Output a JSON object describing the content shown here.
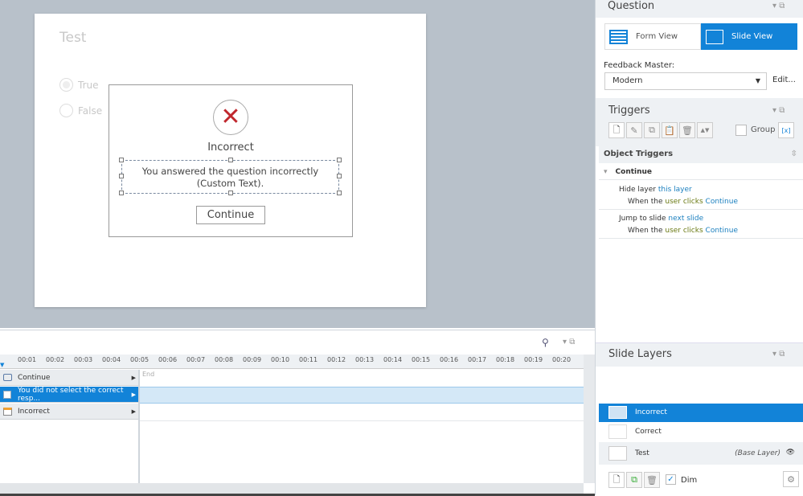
{
  "slide": {
    "title": "Test",
    "options": [
      "True",
      "False"
    ],
    "feedback_title": "Incorrect",
    "feedback_text": "You answered the question incorrectly (Custom Text).",
    "continue_label": "Continue"
  },
  "timeline": {
    "ticks": [
      "00:01",
      "00:02",
      "00:03",
      "00:04",
      "00:05",
      "00:06",
      "00:07",
      "00:08",
      "00:09",
      "00:10",
      "00:11",
      "00:12",
      "00:13",
      "00:14",
      "00:15",
      "00:16",
      "00:17",
      "00:18",
      "00:19",
      "00:20"
    ],
    "end_label": "End",
    "rows": [
      {
        "label": "Continue"
      },
      {
        "label": "You did not select the correct resp..."
      },
      {
        "label": "Incorrect"
      }
    ]
  },
  "question": {
    "title": "Question",
    "form_view": "Form View",
    "slide_view": "Slide View",
    "feedback_master_label": "Feedback Master:",
    "feedback_master_value": "Modern",
    "edit_label": "Edit..."
  },
  "triggers": {
    "title": "Triggers",
    "group_label": "Group",
    "object_triggers": "Object Triggers",
    "object": "Continue",
    "items": [
      {
        "action": "Hide layer",
        "target": "this layer",
        "when": "When the",
        "who": "user clicks",
        "obj": "Continue"
      },
      {
        "action": "Jump to slide",
        "target": "next slide",
        "when": "When the",
        "who": "user clicks",
        "obj": "Continue"
      }
    ]
  },
  "layers": {
    "title": "Slide Layers",
    "items": [
      {
        "name": "Incorrect"
      },
      {
        "name": "Correct"
      },
      {
        "name": "Test",
        "note": "(Base Layer)"
      }
    ],
    "dim_label": "Dim"
  },
  "colors": {
    "accent": "#1283d8",
    "stage": "#b8c1ca"
  }
}
